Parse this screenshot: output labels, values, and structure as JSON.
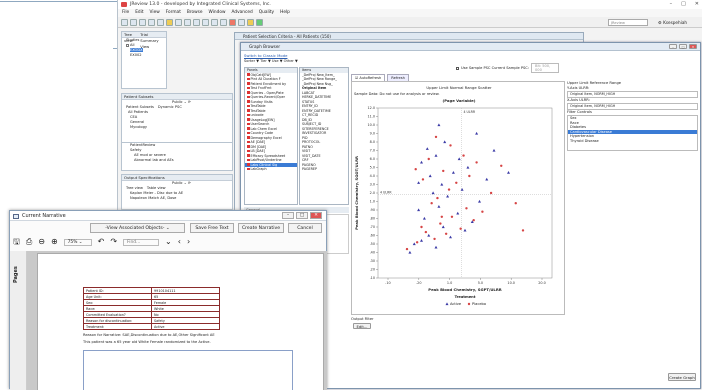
{
  "app": {
    "title": "JReview 13.0 - developed by Integrated Clinical Systems, Inc.",
    "menu": [
      "File",
      "Edit",
      "View",
      "Format",
      "Browse",
      "Window",
      "Advanced",
      "Quality",
      "Help"
    ],
    "search_placeholder": "JReview",
    "user": "Ksespehiah"
  },
  "left_pane": {
    "tabs": [
      "Tree view",
      "Trial Summary View"
    ],
    "studies_label": "Studies",
    "studies": [
      "All",
      "EXODX",
      "EX002"
    ],
    "subsets_label": "Patient Subsets",
    "subsets_public": "Public",
    "subset_tabs": [
      "Patient Subsets",
      "Dynamic PSC"
    ],
    "subset_items": [
      "All Patients",
      "CEA",
      "General",
      "Mycology",
      "PatientReview",
      "Safety",
      "AE mod or severe",
      "Abnormal lab and AEs"
    ],
    "output_label": "Output Specifications",
    "output_public": "Public",
    "output_tabs": [
      "Tree view",
      "Table view"
    ],
    "output_items": [
      "Kaplan Meier - Disc due to AE",
      "Napoleon Match AE, Dose",
      "Napoleon Match AE, Dose 2"
    ]
  },
  "psc": {
    "title": "Patient Selection Criteria - All Patients (150)"
  },
  "graph_browser": {
    "title": "Graph Browser",
    "switch_link": "Switch to Classic Mode",
    "filter_bar": "Sorter ▼  Tier ▼  Use ▼  Other ▼",
    "panels_header": "Panels",
    "items_header": "Items",
    "panels": [
      "ObjCatt[EW]",
      "Ptnt All Duration F",
      "Patient Enrollment by",
      "Test FnxfFmt",
      "Queries - Open/Pate",
      "Queries-Recent/Oper",
      "Sunday Visits",
      "TestTable",
      "TestTable",
      "unicode",
      "UsageLog[EW]",
      "UserSearch",
      "Lab Chem Excel",
      "Country Code",
      "Demography Excel",
      "AE [DAE]",
      "DM [DAE]",
      "LB [DAE]",
      "Efficacy Spreadsheet",
      "LabPivot/Underline",
      "Labs Clinical Sig",
      "LabGraph"
    ],
    "items": [
      "_DefProj New_Item_",
      "_DefProj New Range_",
      "_DefProj New Nsg_",
      "Original Item",
      "LABCAT",
      "HERKE_DATETIME",
      "STATUS",
      "ENTRY_ID",
      "ENTRY_DATETIME",
      "CT_RECID",
      "DB_ID",
      "SUBJECT_ID",
      "SITEREFERENCE",
      "INVESTIGATOR",
      "PID",
      "PROTOCOL",
      "PATNO",
      "VISIT",
      "VISIT_DATE",
      "CRF",
      "PAGENO",
      "PAGEREP"
    ],
    "general_label": "General",
    "tabs": [
      "AutoRefresh",
      "Refresh"
    ],
    "use_sample_label": "Use Sample PSC  Current Sample PSC:",
    "sample_psc_value": "Blt: 500, 000",
    "chart_title": "Upper Limit Normal Range Scatter",
    "page_variable": "(Page Variable)",
    "sample_note": "Sample Data: Do not use for analysis or review.",
    "right_title": "Upper Limit Reference Range",
    "yaxis_label": "Y-Axis ULRR:",
    "yaxis_value": "Original Item, NORM_HIGH",
    "xaxis_label": "X-Axis ULRR:",
    "xaxis_value": "Original Item, NORM_HIGH",
    "filter_controls_label": "Filter Controls",
    "filter_items": [
      "Sex",
      "Race",
      "Diabetes",
      "Cardiovascular Disease",
      "Hypertension",
      "Thyroid Disease"
    ],
    "filter_selected": "Cardiovascular Disease",
    "output_filter": "Output Filter",
    "edit_btn": "Edit...",
    "create_graph": "Create Graph",
    "chart_data": {
      "type": "scatter",
      "title": "(Page Variable)",
      "xlabel": "Peak Blood Chemistry, SGPT/ULRR",
      "ylabel": "Peak Blood Chemistry, SGOT/ULRR",
      "x_ticks": [
        ".10",
        ".20",
        "1.0",
        "5.0",
        "10.0",
        "20.0"
      ],
      "y_ticks": [
        "12.0",
        "11.0",
        "10.0",
        "9.0",
        "8.0",
        "7.0",
        "6.0",
        "5.0",
        "4.0",
        "3.0",
        "2.0",
        "1.0",
        ".90",
        ".80",
        ".70",
        ".60",
        ".50",
        ".40",
        ".30",
        ".20",
        ".10"
      ],
      "ref_label_top": "4 ULRR",
      "ref_label_left": "4 ULRR",
      "legend_title": "Treatment",
      "series": [
        {
          "name": "Active",
          "color": "#3b3ba6",
          "marker": "triangle",
          "points": [
            [
              0.52,
              0.15
            ],
            [
              0.55,
              0.2
            ],
            [
              0.6,
              0.22
            ],
            [
              0.65,
              0.25
            ],
            [
              0.7,
              0.18
            ],
            [
              0.75,
              0.3
            ],
            [
              0.8,
              0.24
            ],
            [
              0.62,
              0.35
            ],
            [
              0.58,
              0.4
            ],
            [
              0.72,
              0.42
            ],
            [
              0.85,
              0.38
            ],
            [
              0.9,
              0.28
            ],
            [
              0.95,
              0.33
            ],
            [
              1.0,
              0.45
            ],
            [
              0.68,
              0.5
            ],
            [
              0.74,
              0.55
            ],
            [
              0.66,
              0.6
            ],
            [
              0.82,
              0.62
            ],
            [
              0.78,
              0.48
            ],
            [
              0.88,
              0.52
            ],
            [
              0.92,
              0.65
            ],
            [
              1.05,
              0.58
            ],
            [
              0.6,
              0.68
            ],
            [
              0.7,
              0.72
            ],
            [
              0.76,
              0.8
            ],
            [
              0.64,
              0.76
            ],
            [
              0.86,
              0.7
            ],
            [
              1.1,
              0.75
            ],
            [
              0.98,
              0.85
            ],
            [
              0.72,
              0.9
            ],
            [
              0.58,
              0.56
            ],
            [
              1.2,
              0.62
            ]
          ]
        },
        {
          "name": "Placebo",
          "color": "#d64545",
          "marker": "circle",
          "points": [
            [
              0.5,
              0.17
            ],
            [
              0.57,
              0.21
            ],
            [
              0.63,
              0.27
            ],
            [
              0.69,
              0.23
            ],
            [
              0.73,
              0.32
            ],
            [
              0.77,
              0.26
            ],
            [
              0.81,
              0.36
            ],
            [
              0.87,
              0.29
            ],
            [
              0.91,
              0.41
            ],
            [
              0.96,
              0.34
            ],
            [
              1.02,
              0.39
            ],
            [
              0.67,
              0.44
            ],
            [
              0.71,
              0.47
            ],
            [
              0.79,
              0.52
            ],
            [
              0.84,
              0.56
            ],
            [
              0.61,
              0.58
            ],
            [
              0.75,
              0.63
            ],
            [
              0.93,
              0.6
            ],
            [
              1.08,
              0.5
            ],
            [
              0.89,
              0.72
            ],
            [
              0.65,
              0.7
            ],
            [
              0.8,
              0.78
            ],
            [
              0.98,
              0.68
            ],
            [
              1.15,
              0.66
            ],
            [
              0.56,
              0.64
            ],
            [
              0.7,
              0.83
            ],
            [
              1.25,
              0.44
            ],
            [
              0.6,
              0.3
            ],
            [
              0.74,
              0.36
            ],
            [
              1.3,
              0.28
            ]
          ]
        }
      ]
    }
  },
  "narrative": {
    "title": "Current Narrative",
    "view_objects": "-View Associated Objects-",
    "save_free_text": "Save Free Text",
    "create_narrative": "Create Narrative",
    "cancel": "Cancel",
    "zoom": "75%",
    "find_placeholder": "Find...",
    "pages_label": "Pages",
    "table": [
      [
        "Patient ID:",
        "9910104111"
      ],
      [
        "Age Unit:",
        "65"
      ],
      [
        "Sex:",
        "Female"
      ],
      [
        "Race:",
        "White"
      ],
      [
        "Committed Evaluation?",
        "No"
      ],
      [
        "Reason for discontinuation:",
        "Safety"
      ],
      [
        "Treatment:",
        "Active"
      ]
    ],
    "reason_line": "Reason for Narrative: SAE,Discontinuation due to AE,Other Significant AE",
    "patient_line": "This patient was a 65 year old White Female randomized to the Active."
  }
}
